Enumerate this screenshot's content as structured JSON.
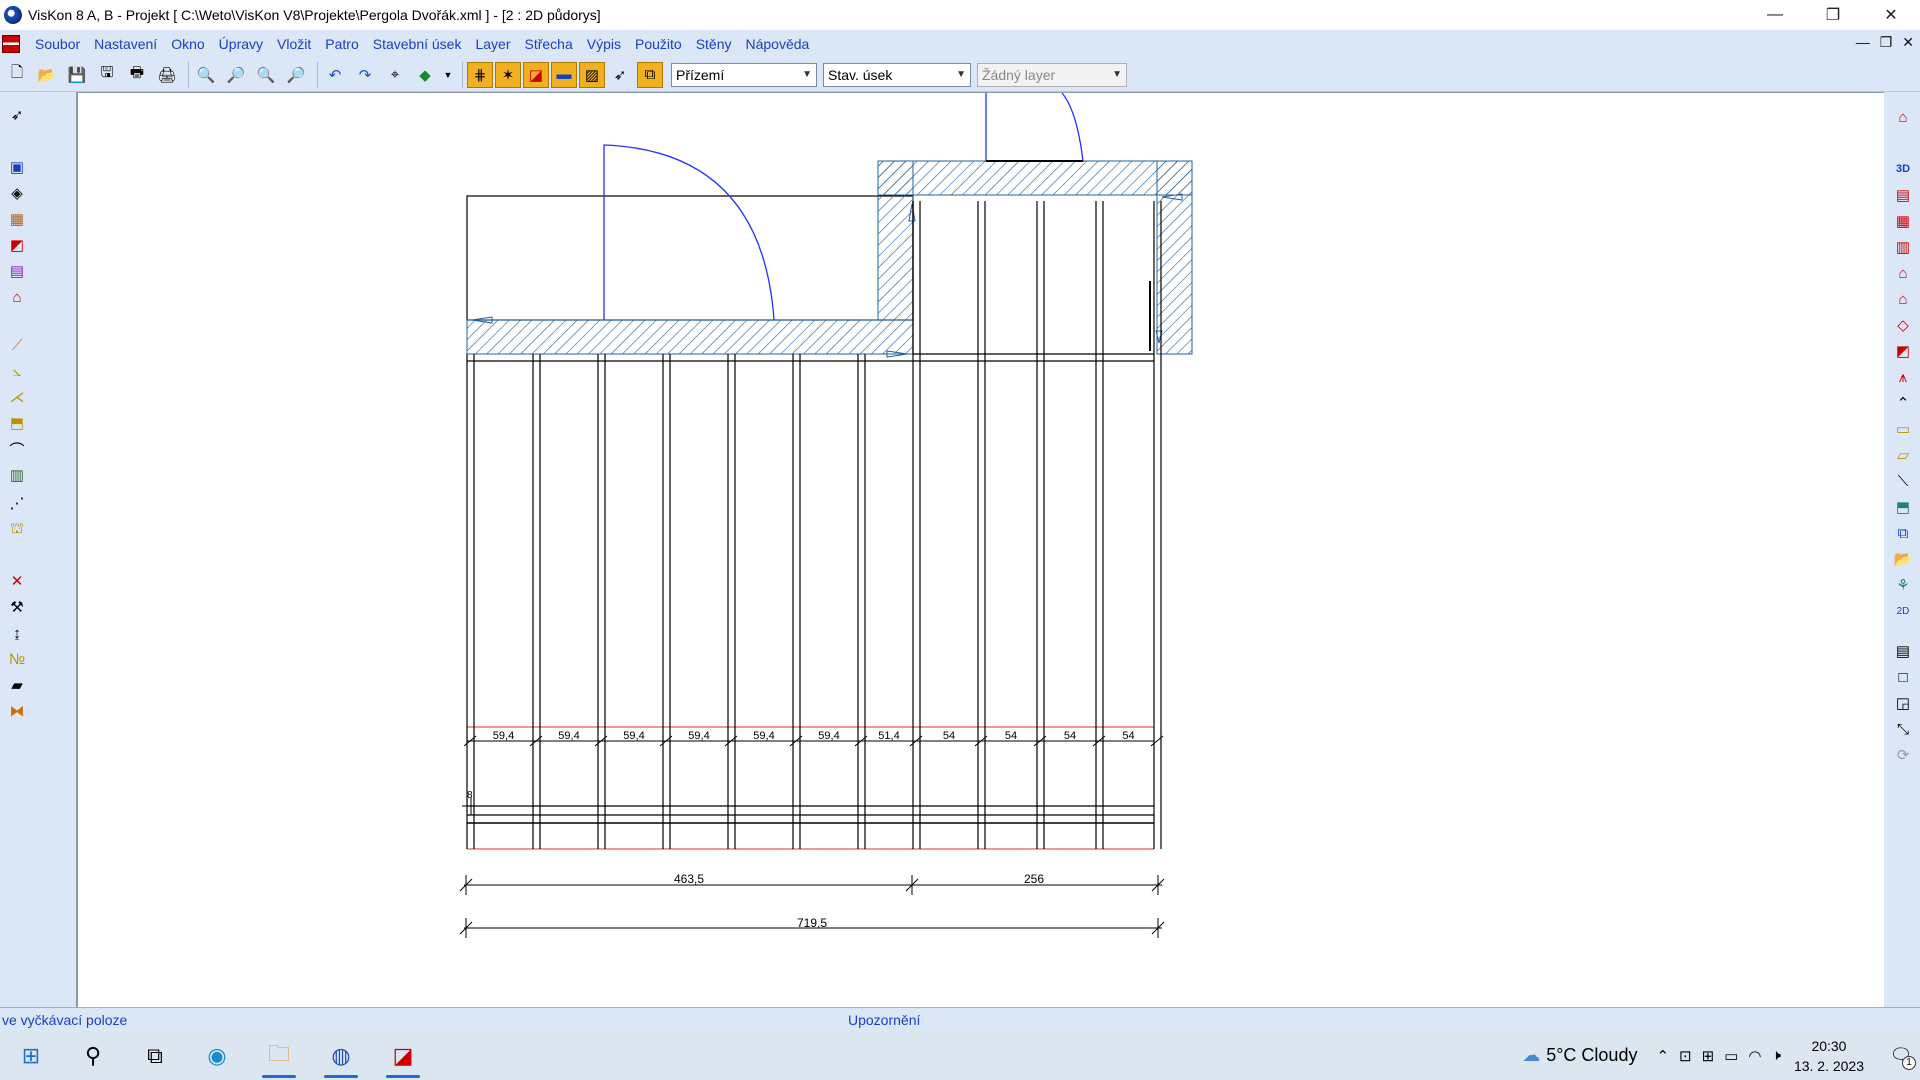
{
  "window": {
    "title": "VisKon 8 A, B - Projekt [ C:\\Weto\\VisKon V8\\Projekte\\Pergola Dvořák.xml ]  - [2 : 2D půdorys]",
    "minimize": "—",
    "restore": "❐",
    "close": "✕"
  },
  "menu": {
    "items": [
      "Soubor",
      "Nastavení",
      "Okno",
      "Úpravy",
      "Vložit",
      "Patro",
      "Stavební úsek",
      "Layer",
      "Střecha",
      "Výpis",
      "Použito",
      "Stěny",
      "Nápověda"
    ],
    "mdi": [
      "—",
      "❐",
      "✕"
    ]
  },
  "toolbar": {
    "floor_select": "Přízemí",
    "section_select": "Stav. úsek",
    "layer_select": "Žádný layer"
  },
  "drawing": {
    "bay_widths": [
      "59,4",
      "59,4",
      "59,4",
      "59,4",
      "59,4",
      "59,4",
      "51,4",
      "54",
      "54",
      "54",
      "54"
    ],
    "dim_left": "463,5",
    "dim_right": "256",
    "dim_total": "719,5",
    "small_label": "8"
  },
  "status": {
    "left": "ve vyčkávací poloze",
    "center": "Upozornění"
  },
  "taskbar": {
    "weather": "5°C  Cloudy",
    "time": "20:30",
    "date": "13. 2. 2023",
    "notifications": "1"
  },
  "colors": {
    "chrome": "#dbe7f7",
    "menu_text": "#1a40c0",
    "door_swing": "#2233ff",
    "dimension_red": "#e03030"
  }
}
